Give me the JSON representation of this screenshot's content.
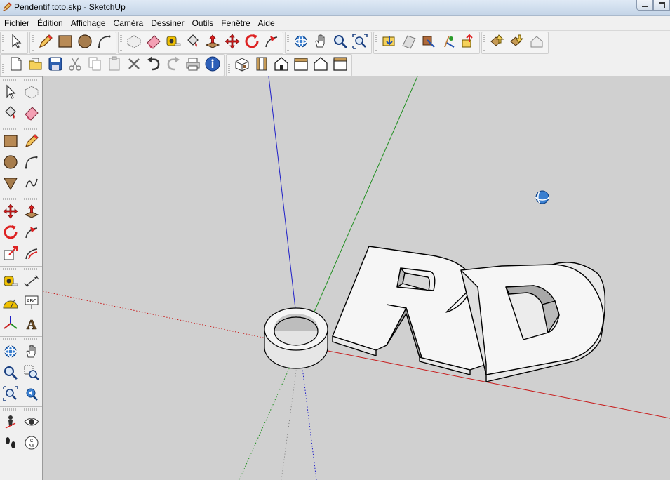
{
  "window": {
    "title": "Pendentif toto.skp - SketchUp",
    "app_icon": "sketchup-pencil-icon",
    "controls": [
      "minimize-icon",
      "maximize-icon"
    ]
  },
  "menu": {
    "items": [
      "Fichier",
      "Édition",
      "Affichage",
      "Caméra",
      "Dessiner",
      "Outils",
      "Fenêtre",
      "Aide"
    ]
  },
  "toolbars": {
    "row1": [
      {
        "group": "principal",
        "tools": [
          "select-icon"
        ]
      },
      {
        "group": "dessin",
        "tools": [
          "pencil-icon",
          "rectangle-icon",
          "circle-icon",
          "arc-icon"
        ]
      },
      {
        "group": "modification",
        "tools": [
          "make-component-icon",
          "eraser-icon",
          "tape-measure-icon",
          "paint-bucket-icon",
          "push-pull-icon",
          "move-icon",
          "rotate-icon",
          "follow-me-icon"
        ]
      },
      {
        "group": "camera",
        "tools": [
          "orbit-icon",
          "pan-icon",
          "zoom-icon",
          "zoom-extents-icon"
        ]
      },
      {
        "group": "google",
        "tools": [
          "get-current-view-icon",
          "toggle-terrain-icon",
          "place-model-icon",
          "get-models-icon",
          "share-model-icon"
        ]
      },
      {
        "group": "composants",
        "tools": [
          "share-component-icon",
          "get-component-icon",
          "house-3d-icon"
        ]
      }
    ],
    "row2": [
      {
        "group": "standard",
        "tools": [
          "new-icon",
          "open-icon",
          "save-icon",
          "cut-icon",
          "copy-icon",
          "paste-icon",
          "delete-icon",
          "undo-icon",
          "redo-icon",
          "print-icon",
          "model-info-icon"
        ]
      },
      {
        "group": "vues",
        "tools": [
          "iso-view-icon",
          "top-view-icon",
          "front-view-icon",
          "right-view-icon",
          "back-view-icon",
          "left-view-icon"
        ]
      }
    ]
  },
  "sidebar": {
    "groups": [
      [
        [
          "select-icon",
          "make-component-icon"
        ],
        [
          "paint-bucket-icon",
          "eraser-icon"
        ]
      ],
      [
        [
          "rectangle-icon",
          "pencil-icon"
        ],
        [
          "circle-icon",
          "arc-icon"
        ],
        [
          "polygon-icon",
          "freehand-icon"
        ]
      ],
      [
        [
          "move-icon",
          "push-pull-icon"
        ],
        [
          "rotate-icon",
          "follow-me-icon"
        ],
        [
          "scale-icon",
          "offset-icon"
        ]
      ],
      [
        [
          "tape-measure-icon",
          "dimension-icon"
        ],
        [
          "protractor-icon",
          "text-icon"
        ],
        [
          "axes-icon",
          "3d-text-icon"
        ]
      ],
      [
        [
          "orbit-icon",
          "pan-icon"
        ],
        [
          "zoom-icon",
          "zoom-window-icon"
        ],
        [
          "zoom-extents-icon",
          "previous-view-icon"
        ]
      ],
      [
        [
          "position-camera-icon",
          "look-around-icon"
        ],
        [
          "walk-icon",
          "section-plane-icon"
        ]
      ]
    ]
  },
  "viewport": {
    "background_color": "#d0d0d0",
    "axis_colors": {
      "red": "#c81e1e",
      "green": "#1f8f1f",
      "blue": "#1e1ec8"
    },
    "model_faces_color": "#f5f5f5",
    "cursor": "orbit-icon"
  }
}
